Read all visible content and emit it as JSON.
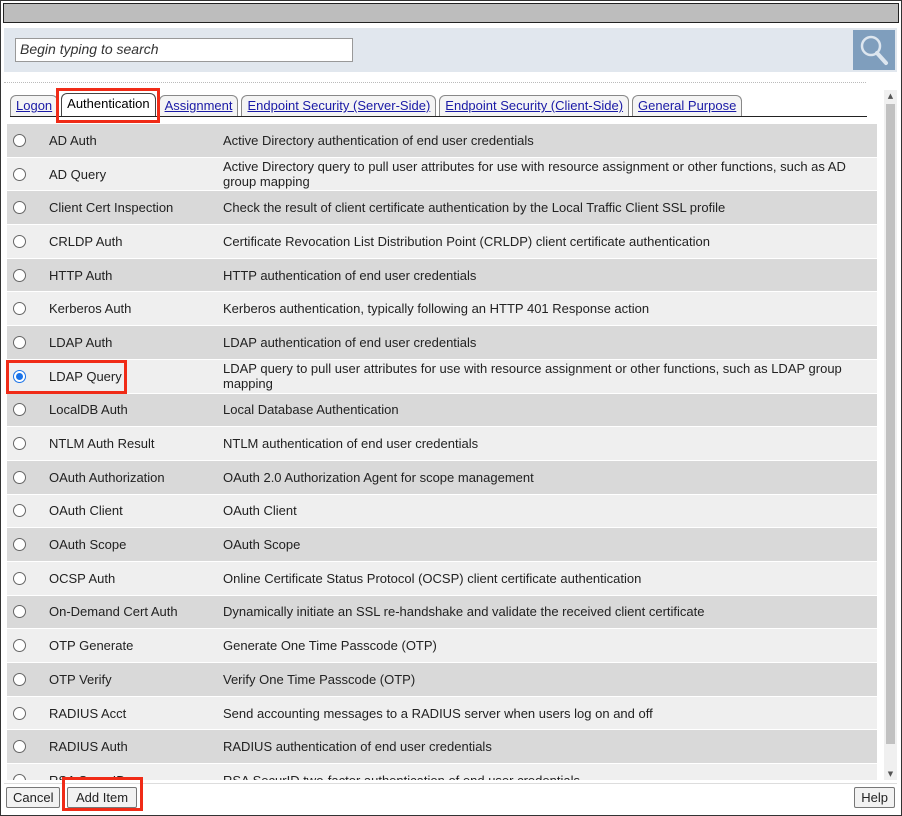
{
  "search": {
    "placeholder": "Begin typing to search",
    "icon": "magnifier-icon"
  },
  "tabs": [
    {
      "label": "Logon"
    },
    {
      "label": "Authentication",
      "active": true
    },
    {
      "label": "Assignment"
    },
    {
      "label": "Endpoint Security (Server-Side)"
    },
    {
      "label": "Endpoint Security (Client-Side)"
    },
    {
      "label": "General Purpose"
    }
  ],
  "items": [
    {
      "name": "AD Auth",
      "desc": "Active Directory authentication of end user credentials"
    },
    {
      "name": "AD Query",
      "desc": "Active Directory query to pull user attributes for use with resource assignment or other functions, such as AD group mapping"
    },
    {
      "name": "Client Cert Inspection",
      "desc": "Check the result of client certificate authentication by the Local Traffic Client SSL profile"
    },
    {
      "name": "CRLDP Auth",
      "desc": "Certificate Revocation List Distribution Point (CRLDP) client certificate authentication"
    },
    {
      "name": "HTTP Auth",
      "desc": "HTTP authentication of end user credentials"
    },
    {
      "name": "Kerberos Auth",
      "desc": "Kerberos authentication, typically following an HTTP 401 Response action"
    },
    {
      "name": "LDAP Auth",
      "desc": "LDAP authentication of end user credentials"
    },
    {
      "name": "LDAP Query",
      "desc": "LDAP query to pull user attributes for use with resource assignment or other functions, such as LDAP group mapping",
      "selected": true
    },
    {
      "name": "LocalDB Auth",
      "desc": "Local Database Authentication"
    },
    {
      "name": "NTLM Auth Result",
      "desc": "NTLM authentication of end user credentials"
    },
    {
      "name": "OAuth Authorization",
      "desc": "OAuth 2.0 Authorization Agent for scope management"
    },
    {
      "name": "OAuth Client",
      "desc": "OAuth Client"
    },
    {
      "name": "OAuth Scope",
      "desc": "OAuth Scope"
    },
    {
      "name": "OCSP Auth",
      "desc": "Online Certificate Status Protocol (OCSP) client certificate authentication"
    },
    {
      "name": "On-Demand Cert Auth",
      "desc": "Dynamically initiate an SSL re-handshake and validate the received client certificate"
    },
    {
      "name": "OTP Generate",
      "desc": "Generate One Time Passcode (OTP)"
    },
    {
      "name": "OTP Verify",
      "desc": "Verify One Time Passcode (OTP)"
    },
    {
      "name": "RADIUS Acct",
      "desc": "Send accounting messages to a RADIUS server when users log on and off"
    },
    {
      "name": "RADIUS Auth",
      "desc": "RADIUS authentication of end user credentials"
    },
    {
      "name": "RSA SecurID",
      "desc": "RSA SecurID two-factor authentication of end user credentials"
    }
  ],
  "footer": {
    "cancel": "Cancel",
    "add": "Add Item",
    "help": "Help"
  },
  "colors": {
    "highlight": "#f02b17",
    "link": "#1a1aa6",
    "selected_radio": "#1a73e8"
  }
}
